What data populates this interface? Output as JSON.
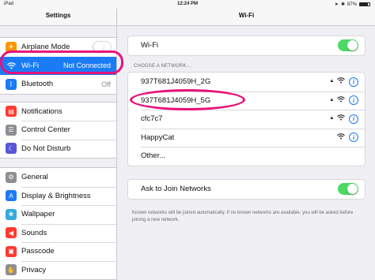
{
  "status_bar": {
    "device": "iPad",
    "time": "12:24 PM",
    "battery": "87%"
  },
  "sidebar": {
    "title": "Settings",
    "groups": [
      [
        {
          "label": "Airplane Mode",
          "icon": "airplane-icon",
          "color": "#ff9500",
          "control": "toggle-off"
        },
        {
          "label": "Wi-Fi",
          "value": "Not Connected",
          "icon": "wifi-icon",
          "color": "#1b7bf5",
          "selected": true
        },
        {
          "label": "Bluetooth",
          "value": "Off",
          "icon": "bluetooth-icon",
          "color": "#1b7bf5"
        }
      ],
      [
        {
          "label": "Notifications",
          "icon": "notifications-icon",
          "color": "#ff3b30"
        },
        {
          "label": "Control Center",
          "icon": "control-center-icon",
          "color": "#8e8e93"
        },
        {
          "label": "Do Not Disturb",
          "icon": "moon-icon",
          "color": "#5856d6"
        }
      ],
      [
        {
          "label": "General",
          "icon": "gear-icon",
          "color": "#8e8e93"
        },
        {
          "label": "Display & Brightness",
          "icon": "brightness-icon",
          "color": "#1b7bf5"
        },
        {
          "label": "Wallpaper",
          "icon": "wallpaper-icon",
          "color": "#34aadc"
        },
        {
          "label": "Sounds",
          "icon": "speaker-icon",
          "color": "#ff3b30"
        },
        {
          "label": "Passcode",
          "icon": "passcode-icon",
          "color": "#ff3b30"
        },
        {
          "label": "Privacy",
          "icon": "privacy-icon",
          "color": "#8e8e93"
        }
      ]
    ]
  },
  "main": {
    "title": "Wi-Fi",
    "wifi_label": "Wi-Fi",
    "wifi_enabled": true,
    "networks_header": "CHOOSE A NETWORK...",
    "networks": [
      {
        "name": "937T681J4059H_2G",
        "locked": true
      },
      {
        "name": "937T681J4059H_5G",
        "locked": true
      },
      {
        "name": "cfc7c7",
        "locked": true
      },
      {
        "name": "HappyCat",
        "locked": false
      },
      {
        "name": "Other...",
        "other": true
      }
    ],
    "ask_label": "Ask to Join Networks",
    "ask_enabled": true,
    "ask_note": "Known networks will be joined automatically. If no known networks are available, you will be asked before joining a new network."
  },
  "annotation_color": "#e8127b"
}
